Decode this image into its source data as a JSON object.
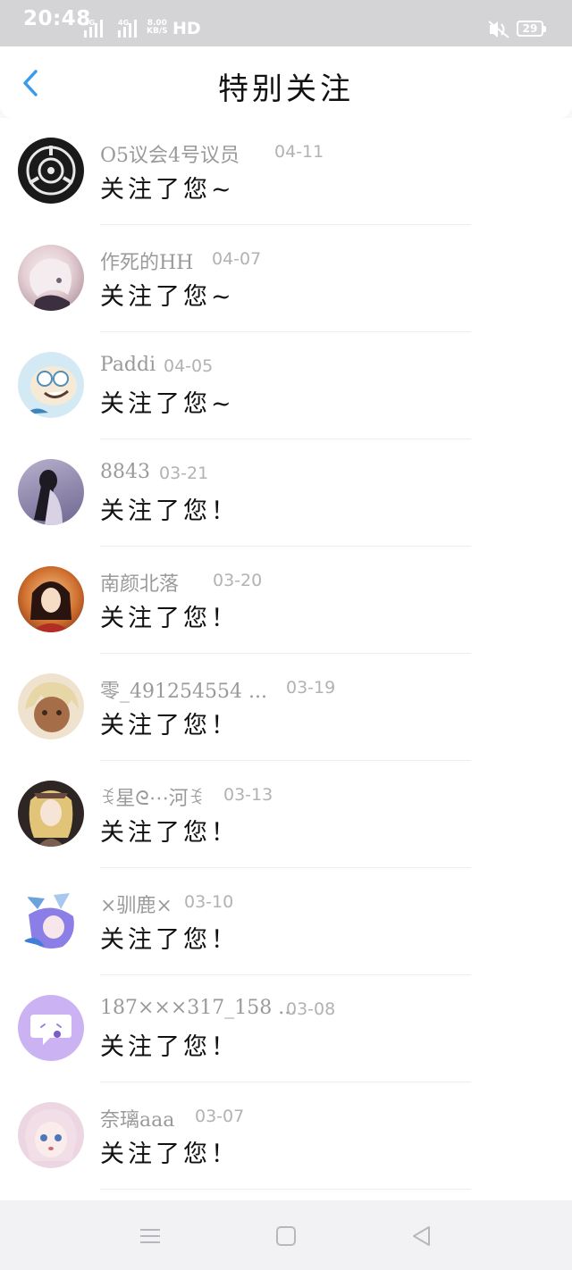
{
  "status_bar": {
    "time": "20:48",
    "net_speed_value": "8.00",
    "net_speed_unit": "KB/S",
    "hd_label": "HD",
    "battery": "29",
    "icons": [
      "signal-4g-icon",
      "signal-4g-icon",
      "mute-icon",
      "battery-icon"
    ]
  },
  "header": {
    "title": "特别关注",
    "back_icon": "chevron-left-icon",
    "accent": "#3a9bec"
  },
  "items": [
    {
      "name": "O5议会4号议员",
      "date": "04-11",
      "message": "关注了您~",
      "avatar_color": "#1a1a1a"
    },
    {
      "name": "作死的HH",
      "date": "04-07",
      "message": "关注了您~",
      "avatar_color": "#e9d9dc"
    },
    {
      "name": "Paddi",
      "date": "04-05",
      "message": "关注了您~",
      "avatar_color": "#cfe6f0"
    },
    {
      "name": "8843",
      "date": "03-21",
      "message": "关注了您！",
      "avatar_color": "#8a82a6"
    },
    {
      "name": "南颜北落",
      "date": "03-20",
      "message": "关注了您！",
      "avatar_color": "#b5542c"
    },
    {
      "name": "零_491254554 ...",
      "date": "03-19",
      "message": "关注了您！",
      "avatar_color": "#e6d2b4"
    },
    {
      "name": "ꉂ星ᘓ⋯河ꉂ",
      "date": "03-13",
      "message": "关注了您！",
      "avatar_color": "#3a3230"
    },
    {
      "name": "×驯鹿×",
      "date": "03-10",
      "message": "关注了您！",
      "avatar_color": "#7d86d8"
    },
    {
      "name": "187×××317_158 ...",
      "date": "03-08",
      "message": "关注了您！",
      "avatar_color": "#cbb2f2"
    },
    {
      "name": "奈璃aaa",
      "date": "03-07",
      "message": "关注了您！",
      "avatar_color": "#ead0df"
    }
  ],
  "nav_bar": {
    "icons": [
      "menu-icon",
      "home-square-icon",
      "back-triangle-icon"
    ]
  }
}
